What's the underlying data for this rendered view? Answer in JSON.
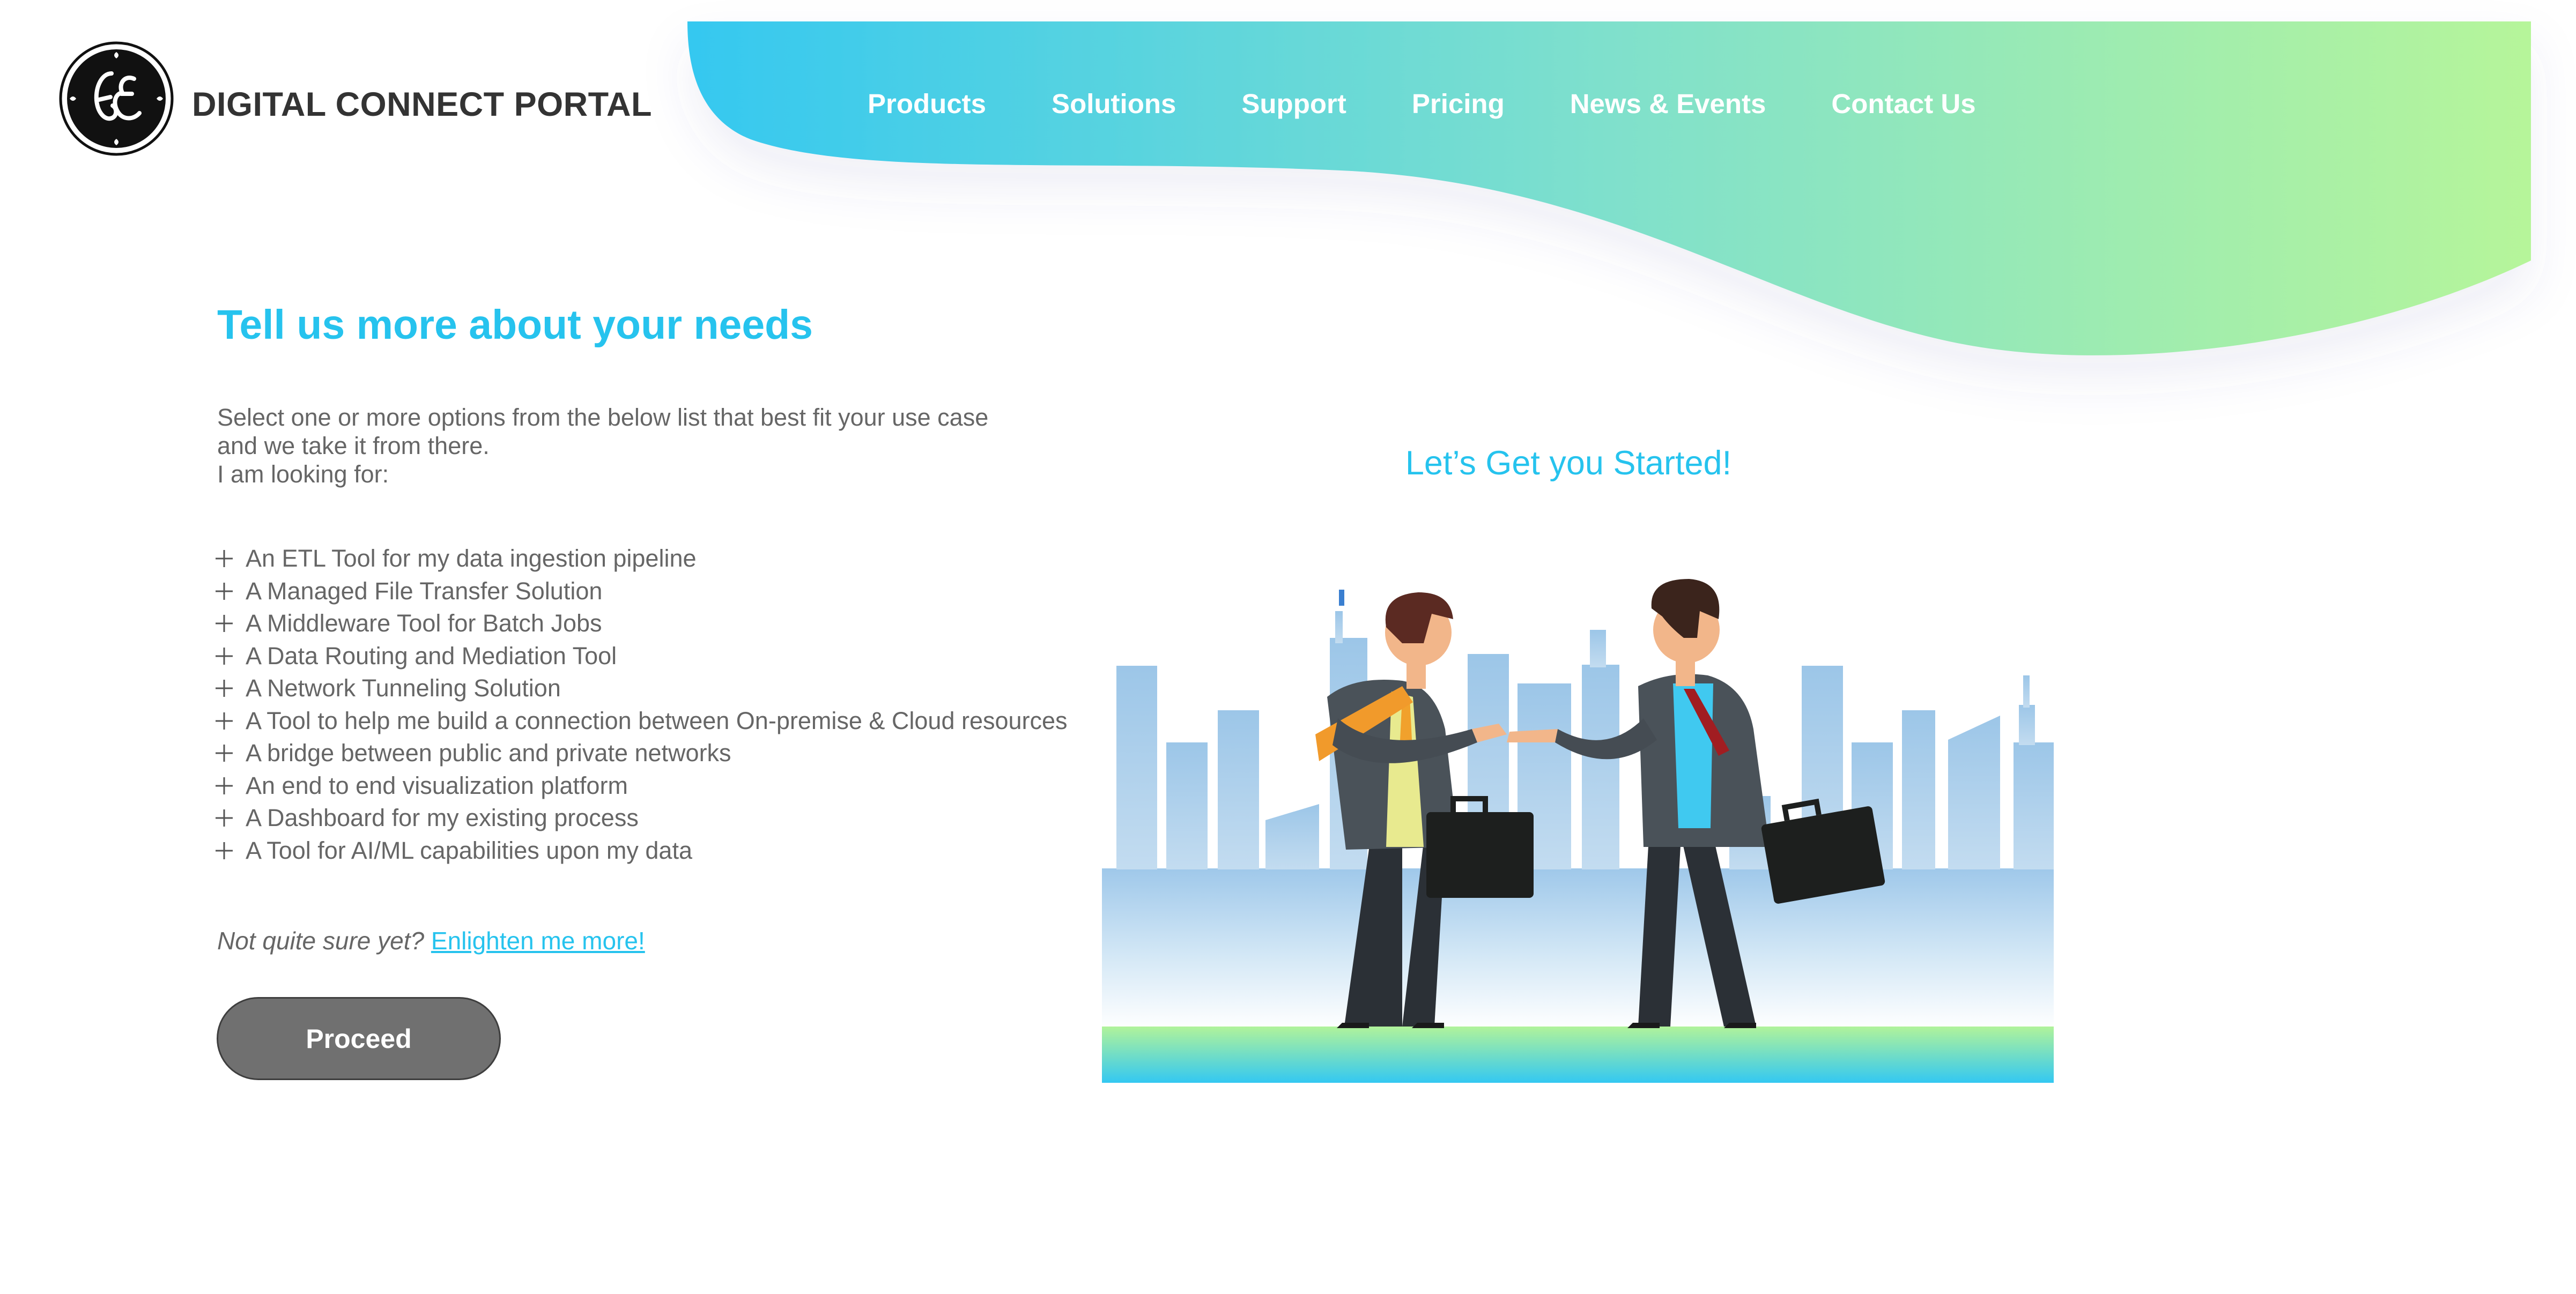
{
  "brand": {
    "logo_icon": "ge-monogram-icon",
    "name": "DIGITAL CONNECT PORTAL"
  },
  "nav": {
    "items": [
      {
        "label": "Products"
      },
      {
        "label": "Solutions"
      },
      {
        "label": "Support"
      },
      {
        "label": "Pricing"
      },
      {
        "label": "News & Events"
      },
      {
        "label": "Contact Us"
      }
    ]
  },
  "main": {
    "heading": "Tell us more about your needs",
    "intro": {
      "line1": "Select one or more options from the below list that best fit your use case",
      "line2": "and we take it from there.",
      "line3": "I am looking for:"
    },
    "options": [
      {
        "label": "An ETL Tool for my data ingestion pipeline"
      },
      {
        "label": "A Managed File Transfer Solution"
      },
      {
        "label": "A Middleware Tool for Batch Jobs"
      },
      {
        "label": "A Data Routing and Mediation Tool"
      },
      {
        "label": "A Network Tunneling Solution"
      },
      {
        "label": "A Tool to help me build a connection between On-premise & Cloud resources"
      },
      {
        "label": "A bridge between public and private networks"
      },
      {
        "label": "An end to end visualization platform"
      },
      {
        "label": "A Dashboard for my existing process"
      },
      {
        "label": "A Tool for AI/ML capabilities upon my data"
      }
    ],
    "option_icon": "plus-icon",
    "hint_text": "Not quite sure yet?",
    "hint_link": "Enlighten me more!",
    "proceed_label": "Proceed"
  },
  "illustration": {
    "tagline": "Let’s Get you Started!",
    "icon": "business-handshake-illustration"
  },
  "colors": {
    "accent": "#26c3ee",
    "header_gradient_start": "#35c8f0",
    "header_gradient_end": "#b6f59a",
    "button": "#707070"
  }
}
